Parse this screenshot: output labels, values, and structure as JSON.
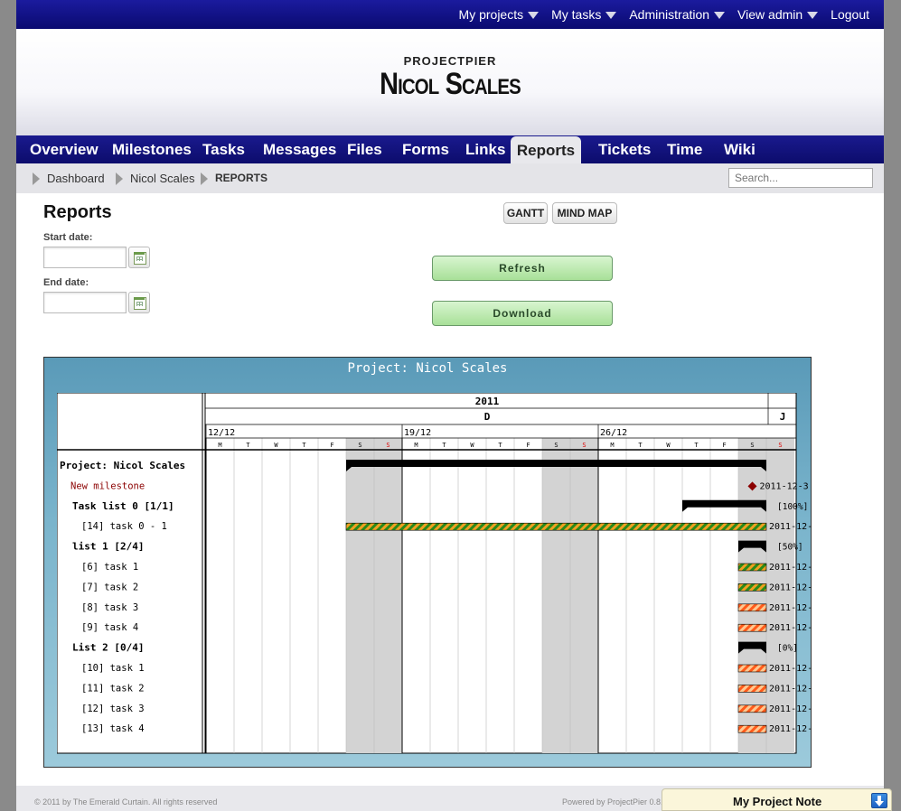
{
  "topnav": [
    "My projects",
    "My tasks",
    "Administration",
    "View admin",
    "Logout"
  ],
  "header": {
    "app": "PROJECTPIER",
    "project": "Nicol Scales"
  },
  "tabs": [
    {
      "label": "Overview"
    },
    {
      "label": "Milestones"
    },
    {
      "label": "Tasks"
    },
    {
      "label": "Messages"
    },
    {
      "label": "Files"
    },
    {
      "label": "Forms"
    },
    {
      "label": "Links"
    },
    {
      "label": "Reports",
      "active": true
    },
    {
      "label": "Tickets"
    },
    {
      "label": "Time"
    },
    {
      "label": "Wiki"
    }
  ],
  "breadcrumb": [
    "Dashboard",
    "Nicol Scales",
    "REPORTS"
  ],
  "search": {
    "placeholder": "Search..."
  },
  "reports": {
    "title": "Reports",
    "start_label": "Start date:",
    "end_label": "End date:",
    "start_value": "",
    "end_value": "",
    "gantt_btn": "GANTT",
    "mindmap_btn": "MIND MAP",
    "refresh_btn": "Refresh",
    "download_btn": "Download"
  },
  "gantt": {
    "title": "Project: Nicol Scales",
    "year": "2011",
    "month1": "D",
    "month2": "J",
    "weeks": [
      "12/12",
      "19/12",
      "26/12"
    ],
    "day_letters": [
      "M",
      "T",
      "W",
      "T",
      "F",
      "S",
      "S",
      "M",
      "T",
      "W",
      "T",
      "F",
      "S",
      "S",
      "M",
      "T",
      "W",
      "T",
      "F",
      "S",
      "S"
    ],
    "rows": [
      {
        "label": "Project: Nicol Scales",
        "type": "project",
        "start": 5,
        "end": 20
      },
      {
        "label": "New milestone",
        "type": "milestone",
        "at": 19.5,
        "note": "2011-12-3"
      },
      {
        "label": "Task list 0 [1/1]",
        "type": "group",
        "start": 17,
        "end": 20,
        "note": "[100%]"
      },
      {
        "label": "[14] task 0 - 1",
        "type": "task",
        "start": 5,
        "end": 20,
        "progress": 1,
        "note": "2011-12-"
      },
      {
        "label": "list 1 [2/4]",
        "type": "group",
        "start": 19,
        "end": 20,
        "note": "[50%]"
      },
      {
        "label": "[6] task 1",
        "type": "task",
        "start": 19,
        "end": 20,
        "progress": 1,
        "note": "2011-12-"
      },
      {
        "label": "[7] task 2",
        "type": "task",
        "start": 19,
        "end": 20,
        "progress": 1,
        "note": "2011-12-"
      },
      {
        "label": "[8] task 3",
        "type": "task",
        "start": 19,
        "end": 20,
        "progress": 0,
        "note": "2011-12-"
      },
      {
        "label": "[9] task 4",
        "type": "task",
        "start": 19,
        "end": 20,
        "progress": 0,
        "note": "2011-12-"
      },
      {
        "label": "List 2 [0/4]",
        "type": "group",
        "start": 19,
        "end": 20,
        "note": "[0%]"
      },
      {
        "label": "[10] task 1",
        "type": "task",
        "start": 19,
        "end": 20,
        "progress": 0,
        "note": "2011-12-"
      },
      {
        "label": "[11] task 2",
        "type": "task",
        "start": 19,
        "end": 20,
        "progress": 0,
        "note": "2011-12-"
      },
      {
        "label": "[12] task 3",
        "type": "task",
        "start": 19,
        "end": 20,
        "progress": 0,
        "note": "2011-12-"
      },
      {
        "label": "[13] task 4",
        "type": "task",
        "start": 19,
        "end": 20,
        "progress": 0,
        "note": "2011-12-"
      }
    ]
  },
  "footer": {
    "copyright": "© 2011 by The Emerald Curtain. All rights reserved",
    "powered": "Powered by ProjectPier 0.8."
  },
  "note": {
    "title": "My Project Note"
  },
  "colors": {
    "nav": "#0c0c6c",
    "tab_active": "#e8e8ec",
    "green_btn": "#a8e098",
    "gantt_bg": "#6aa8c2",
    "milestone": "#8b0000"
  }
}
